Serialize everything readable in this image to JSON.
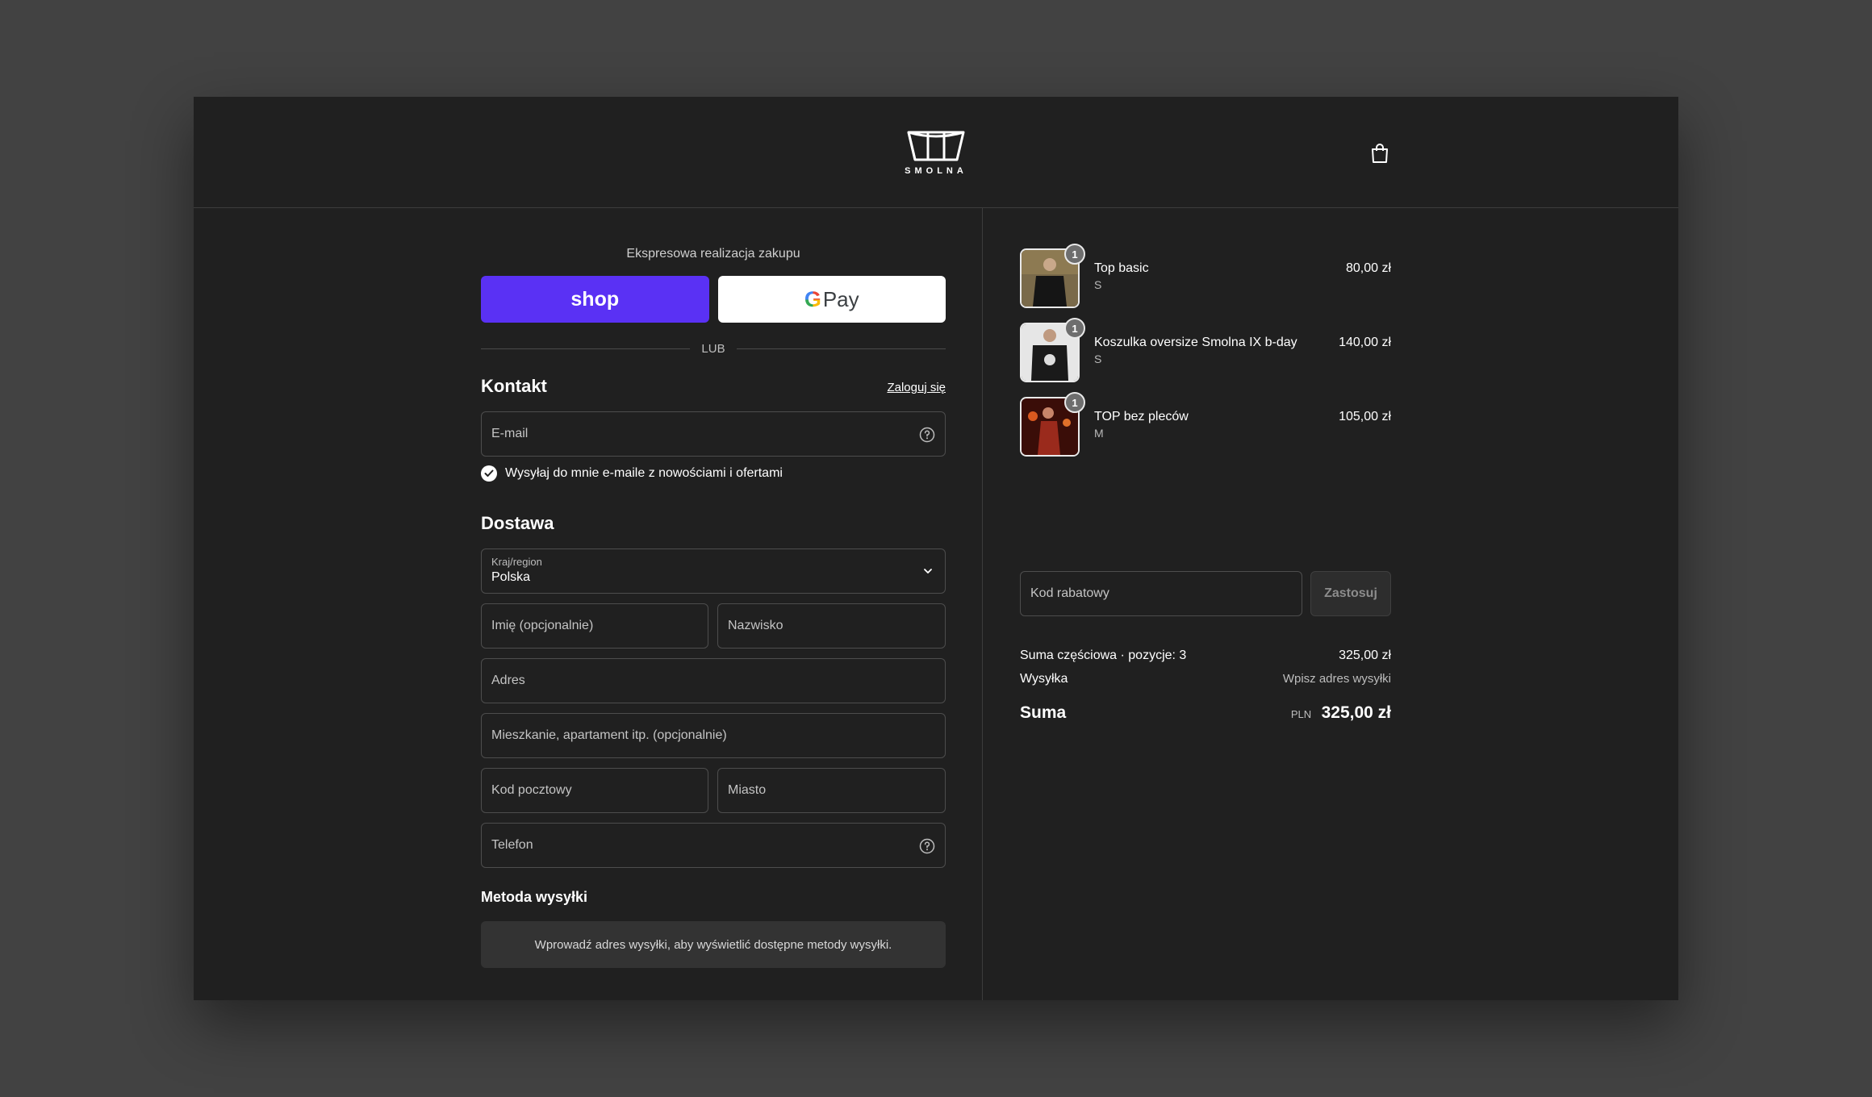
{
  "brand": {
    "name": "SMOLNA"
  },
  "express": {
    "title": "Ekspresowa realizacja zakupu",
    "shop_label": "shop",
    "gpay_g": "G",
    "gpay_label": "Pay",
    "or_label": "LUB"
  },
  "contact": {
    "heading": "Kontakt",
    "login_link": "Zaloguj się",
    "email_placeholder": "E-mail",
    "newsletter_label": "Wysyłaj do mnie e-maile z nowościami i ofertami",
    "newsletter_checked": true
  },
  "delivery": {
    "heading": "Dostawa",
    "country_label": "Kraj/region",
    "country_value": "Polska",
    "first_name_placeholder": "Imię (opcjonalnie)",
    "last_name_placeholder": "Nazwisko",
    "address_placeholder": "Adres",
    "apartment_placeholder": "Mieszkanie, apartament itp. (opcjonalnie)",
    "postal_placeholder": "Kod pocztowy",
    "city_placeholder": "Miasto",
    "phone_placeholder": "Telefon"
  },
  "shipping_method": {
    "heading": "Metoda wysyłki",
    "notice": "Wprowadź adres wysyłki, aby wyświetlić dostępne metody wysyłki."
  },
  "cart": {
    "items": [
      {
        "name": "Top basic",
        "variant": "S",
        "price": "80,00 zł",
        "qty": "1",
        "thumb_color": "#6b5a3e"
      },
      {
        "name": "Koszulka oversize Smolna IX b-day",
        "variant": "S",
        "price": "140,00 zł",
        "qty": "1",
        "thumb_color": "#d9d9d9"
      },
      {
        "name": "TOP bez pleców",
        "variant": "M",
        "price": "105,00 zł",
        "qty": "1",
        "thumb_color": "#5a1a12"
      }
    ],
    "discount_placeholder": "Kod rabatowy",
    "apply_label": "Zastosuj",
    "subtotal_label": "Suma częściowa · pozycje: 3",
    "subtotal_value": "325,00 zł",
    "shipping_label": "Wysyłka",
    "shipping_value": "Wpisz adres wysyłki",
    "total_label": "Suma",
    "total_currency": "PLN",
    "total_value": "325,00 zł"
  },
  "colors": {
    "accent_shop": "#5a31f4",
    "background": "#202020",
    "page": "#424242"
  }
}
